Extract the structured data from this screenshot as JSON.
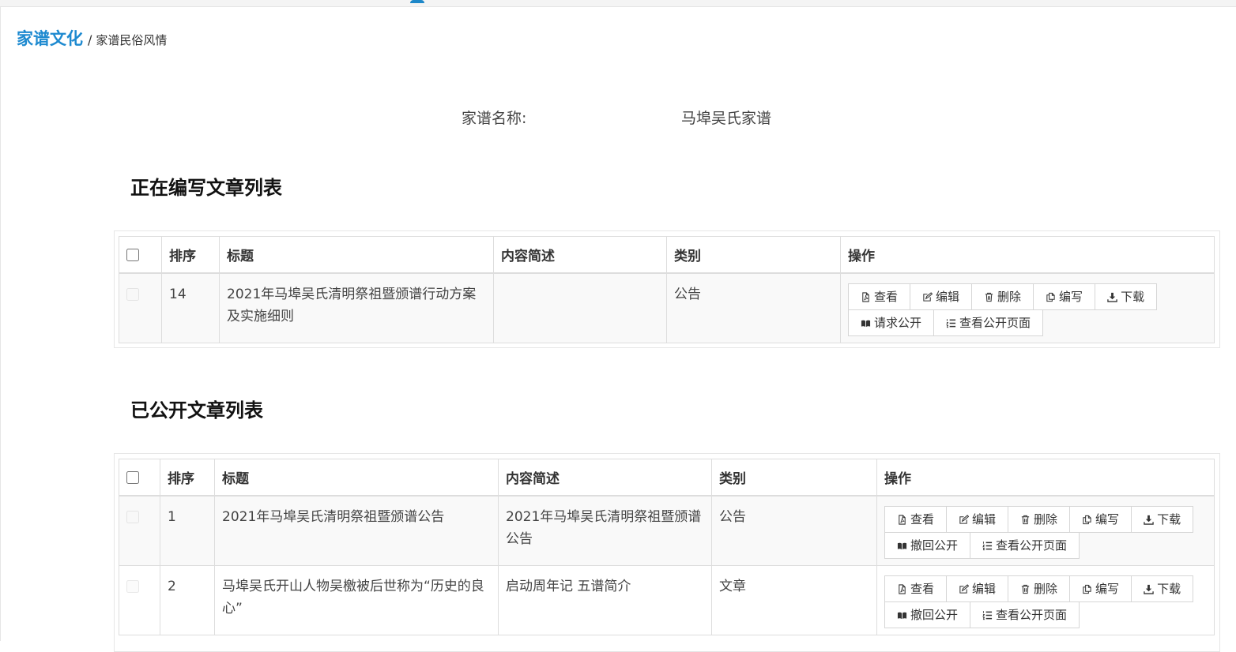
{
  "breadcrumb": {
    "main": "家谱文化",
    "separator": "/",
    "current": "家谱民俗风情"
  },
  "genealogy": {
    "label": "家谱名称:",
    "value": "马埠吴氏家谱"
  },
  "drafts": {
    "title": "正在编写文章列表",
    "columns": {
      "order": "排序",
      "title": "标题",
      "summary": "内容简述",
      "category": "类别",
      "actions": "操作"
    },
    "rows": [
      {
        "order": "14",
        "title": "2021年马埠吴氏清明祭祖暨颁谱行动方案及实施细则",
        "summary": "",
        "category": "公告"
      }
    ],
    "actions": {
      "view": "查看",
      "edit": "编辑",
      "delete": "删除",
      "write": "编写",
      "download": "下载",
      "publish": "请求公开",
      "view_public": "查看公开页面"
    }
  },
  "published": {
    "title": "已公开文章列表",
    "columns": {
      "order": "排序",
      "title": "标题",
      "summary": "内容简述",
      "category": "类别",
      "actions": "操作"
    },
    "rows": [
      {
        "order": "1",
        "title": "2021年马埠吴氏清明祭祖暨颁谱公告",
        "summary": "2021年马埠吴氏清明祭祖暨颁谱公告",
        "category": "公告"
      },
      {
        "order": "2",
        "title": "马埠吴氏开山人物吴檄被后世称为“历史的良心”",
        "summary": "启动周年记 五谱简介",
        "category": "文章"
      }
    ],
    "actions": {
      "view": "查看",
      "edit": "编辑",
      "delete": "删除",
      "write": "编写",
      "download": "下载",
      "withdraw": "撤回公开",
      "view_public": "查看公开页面"
    }
  },
  "icons": {
    "view": "file-pdf-icon",
    "edit": "edit-icon",
    "delete": "trash-icon",
    "write": "copy-icon",
    "download": "download-icon",
    "publish": "book-icon",
    "view_public": "list-ol-icon"
  },
  "colors": {
    "brand": "#1e8ad0"
  }
}
